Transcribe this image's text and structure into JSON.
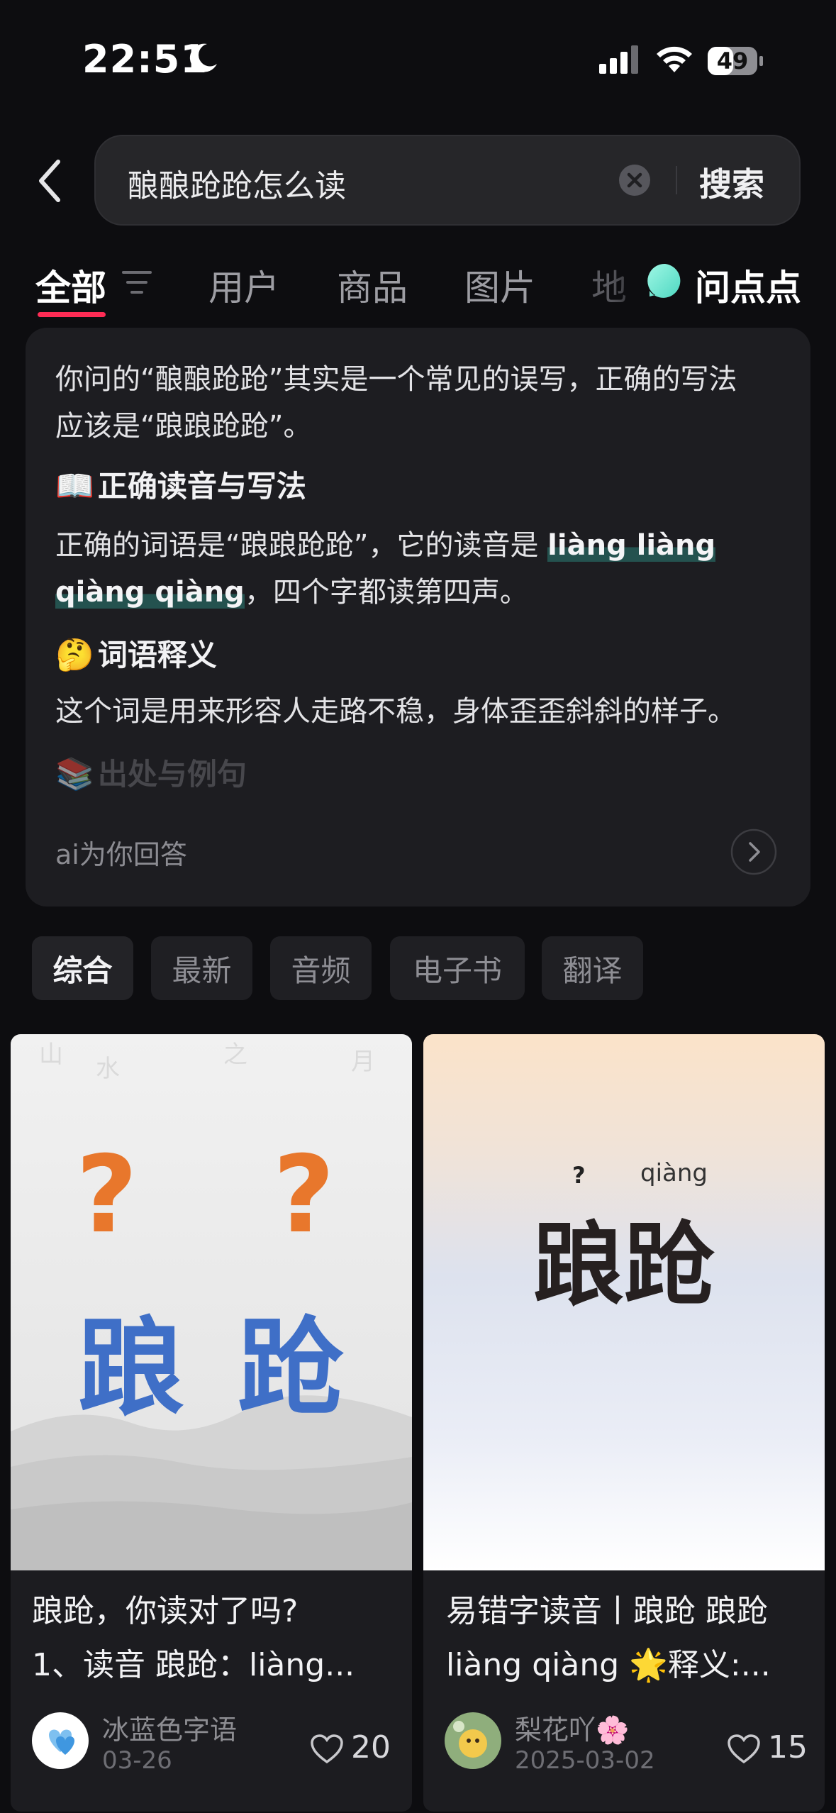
{
  "status_bar": {
    "time": "22:51",
    "battery": "49"
  },
  "search": {
    "query": "酿酿跄跄怎么读",
    "button": "搜索"
  },
  "tabs": {
    "all": "全部",
    "users": "用户",
    "products": "商品",
    "images": "图片",
    "truncated": "地",
    "wendiandian": "问点点"
  },
  "ai_answer": {
    "intro_line1": "你问的“酿酿跄跄”其实是一个常见的误写，正确的写法",
    "intro_line2": "应该是“踉踉跄跄”。",
    "section1_icon": "📖",
    "section1_title": "正确读音与写法",
    "section1_text_a": "正确的词语是“踉踉跄跄”，它的读音是 ",
    "section1_pinyin_a": "liàng liàng",
    "section1_pinyin_b": "qiàng qiàng",
    "section1_text_b": "，四个字都读第四声。",
    "section2_icon": "🤔",
    "section2_title": "词语释义",
    "section2_text": "这个词是用来形容人走路不稳，身体歪歪斜斜的样子。",
    "section3_icon": "📚",
    "section3_title": "出处与例句",
    "footer": "ai为你回答"
  },
  "filters": [
    "综合",
    "最新",
    "音频",
    "电子书",
    "翻译"
  ],
  "results": [
    {
      "image_q1": "?",
      "image_q2": "?",
      "image_char1": "踉",
      "image_char2": "跄",
      "title_line1": "踉跄，你读对了吗?",
      "title_line2": "1、读音 踉跄：liàng...",
      "author": "冰蓝色字语",
      "date": "03-26",
      "likes": "20"
    },
    {
      "image_mark": "?",
      "image_pinyin": "qiàng",
      "image_word": "踉跄",
      "title_line1": "易错字读音丨踉跄 踉跄",
      "title_line2": "liàng qiàng 🌟释义:...",
      "author": "梨花吖🌸",
      "date": "2025-03-02",
      "likes": "15"
    }
  ],
  "colors": {
    "accent": "#fe2c55",
    "background": "#0d0d10",
    "card": "#1d1d21"
  }
}
